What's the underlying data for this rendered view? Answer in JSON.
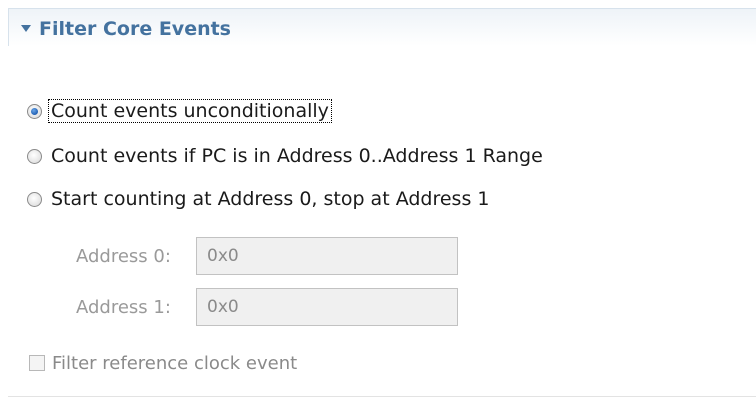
{
  "section": {
    "title": "Filter Core Events",
    "expanded": true
  },
  "options": [
    {
      "label": "Count events unconditionally",
      "selected": true
    },
    {
      "label": "Count events if PC is in Address 0..Address 1 Range",
      "selected": false
    },
    {
      "label": "Start counting at Address 0, stop at Address 1",
      "selected": false
    }
  ],
  "address0": {
    "label": "Address 0:",
    "value": "0x0"
  },
  "address1": {
    "label": "Address 1:",
    "value": "0x0"
  },
  "reference_clock": {
    "label": "Filter reference clock event",
    "checked": false
  },
  "colors": {
    "header_text": "#44729f",
    "disabled_text": "#9a9a9a"
  }
}
